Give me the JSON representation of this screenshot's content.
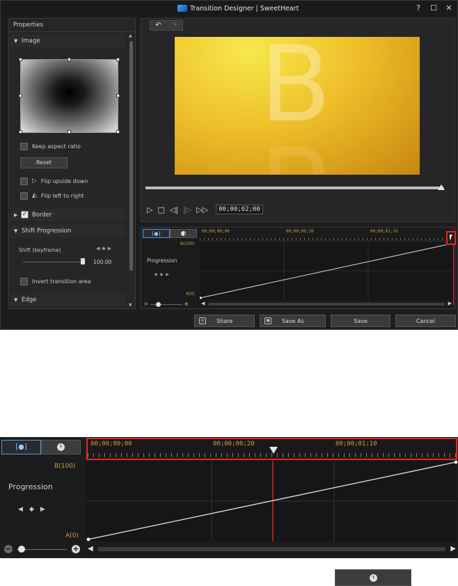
{
  "window": {
    "title": "Transition Designer | SweetHeart",
    "help_glyph": "?",
    "maximize_glyph": "☐",
    "close_glyph": "✕"
  },
  "properties": {
    "header": "Properties",
    "sections": {
      "image": "Image",
      "border": "Border",
      "shift_progression": "Shift Progression",
      "edge": "Edge"
    },
    "keep_aspect_ratio": "Keep aspect ratio",
    "reset_button": "Reset",
    "flip_upside_down": "Flip upside down",
    "flip_left_right": "Flip left to right",
    "border_checked": true,
    "shift_label": "Shift (keyframe)",
    "shift_value": "100.00",
    "invert_transition_area": "Invert transition area"
  },
  "preview": {
    "letter": "B",
    "seek_progress": 1.0
  },
  "playback": {
    "timecode": "00;00;02;00"
  },
  "timeline": {
    "ticks": [
      "00;00;00;00",
      "00;00;00;20",
      "00;00;01;10"
    ],
    "track_label": "Progression",
    "y_max_label": "B(100)",
    "y_min_label": "A(0)"
  },
  "buttons": {
    "share": "Share",
    "save_as": "Save As",
    "save": "Save",
    "cancel": "Cancel"
  },
  "colors": {
    "accent": "#4a9ee6",
    "highlight": "#e22222",
    "timecode": "#c7a23a"
  }
}
